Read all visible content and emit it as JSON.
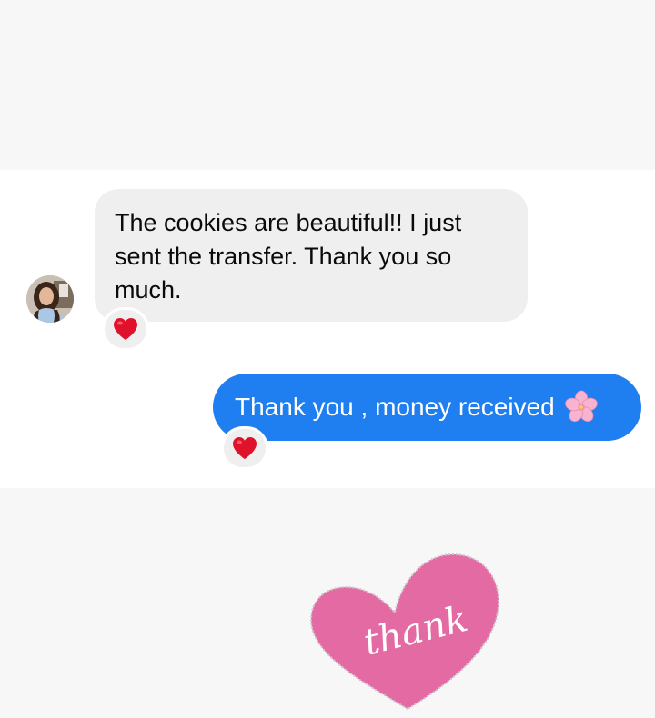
{
  "conversation": {
    "incoming": {
      "text": "The cookies are beautiful!! I just sent the transfer. Thank you so much.",
      "reaction": "red-heart-icon"
    },
    "outgoing": {
      "text": "Thank you , money received",
      "emoji": "cherry-blossom-icon",
      "reaction": "red-heart-icon"
    }
  },
  "decoration": {
    "sticker_text": "thank"
  },
  "colors": {
    "outgoing_bubble": "#1f7ff0",
    "incoming_bubble": "#efefef",
    "heart_red": "#e0122b",
    "sticker_pink": "#e46aa3"
  }
}
